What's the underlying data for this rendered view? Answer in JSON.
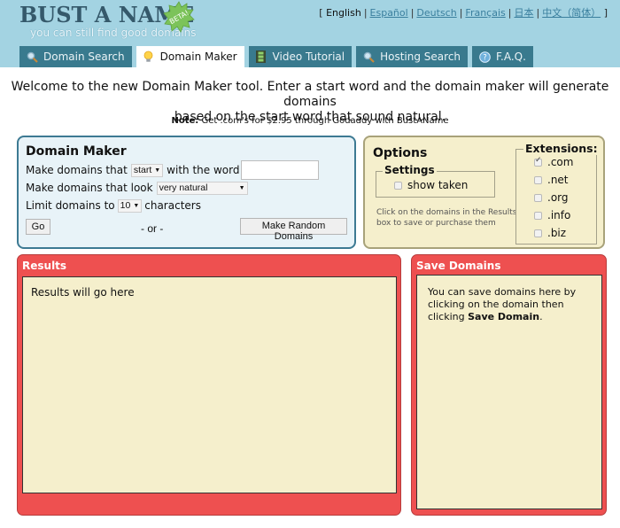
{
  "header": {
    "logo_title": "BUST A NAME",
    "logo_badge": "BETA!",
    "logo_tagline": "you can still find good domains",
    "languages": {
      "open_bracket": "[",
      "close_bracket": "]",
      "items": [
        {
          "label": "English",
          "current": true
        },
        {
          "label": "Español",
          "current": false
        },
        {
          "label": "Deutsch",
          "current": false
        },
        {
          "label": "Français",
          "current": false
        },
        {
          "label": "日本",
          "current": false
        },
        {
          "label": "中文（简体）",
          "current": false
        }
      ]
    },
    "tabs": [
      {
        "label": "Domain Search",
        "icon": "magnifier-icon",
        "active": false
      },
      {
        "label": "Domain Maker",
        "icon": "lightbulb-icon",
        "active": true
      },
      {
        "label": "Video Tutorial",
        "icon": "film-icon",
        "active": false
      },
      {
        "label": "Hosting Search",
        "icon": "magnifier-icon",
        "active": false
      },
      {
        "label": "F.A.Q.",
        "icon": "help-icon",
        "active": false
      }
    ]
  },
  "intro": {
    "line1": "Welcome to the new Domain Maker tool. Enter a start word and the domain maker will generate domains",
    "line2": "based on the start word that sound natural.",
    "note_label": "Note:",
    "note_text": "Get .com's for $2.95 through Godaddy with BustAName"
  },
  "domain_maker": {
    "title": "Domain Maker",
    "row1_prefix": "Make domains that",
    "row1_select": "start",
    "row1_suffix": "with the word",
    "word_input_value": "",
    "row2_prefix": "Make domains that look",
    "row2_select": "very natural",
    "row3_prefix": "Limit domains to",
    "row3_select": "10",
    "row3_suffix": "characters",
    "go_label": "Go",
    "or_label": "- or -",
    "random_label_line1": "Make Random",
    "random_label_line2": "Domains"
  },
  "options": {
    "title": "Options",
    "settings_legend": "Settings",
    "show_taken_label": "show taken",
    "show_taken_checked": false,
    "hint": "Click on the domains in the Results box to save or purchase them",
    "extensions_legend": "Extensions:",
    "extensions": [
      {
        "label": ".com",
        "checked": true
      },
      {
        "label": ".net",
        "checked": false
      },
      {
        "label": ".org",
        "checked": false
      },
      {
        "label": ".info",
        "checked": false
      },
      {
        "label": ".biz",
        "checked": false
      }
    ]
  },
  "results": {
    "title": "Results",
    "placeholder": "Results will go here"
  },
  "save_domains": {
    "title": "Save Domains",
    "text": "You can save domains here by clicking on the domain then clicking",
    "bold": "Save Domain",
    "end": "."
  },
  "colors": {
    "header_bg": "#a3d3e2",
    "tab_bg": "#397a8e",
    "panel_red": "#ee5050",
    "panel_cream": "#f5efcc",
    "panel_blue": "#e8f3f8"
  }
}
